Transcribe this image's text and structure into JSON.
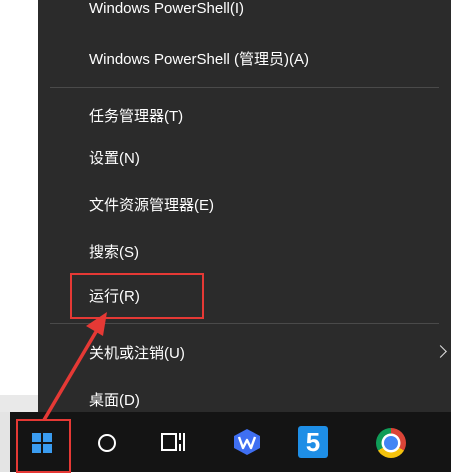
{
  "context_menu": {
    "items": [
      {
        "label": "Windows PowerShell(I)"
      },
      {
        "label": "Windows PowerShell (管理员)(A)"
      },
      {
        "label": "任务管理器(T)"
      },
      {
        "label": "设置(N)"
      },
      {
        "label": "文件资源管理器(E)"
      },
      {
        "label": "搜索(S)"
      },
      {
        "label": "运行(R)"
      },
      {
        "label": "关机或注销(U)"
      },
      {
        "label": "桌面(D)"
      }
    ],
    "submenu_arrow_icon": "chevron-right-icon"
  },
  "taskbar": {
    "icons": [
      "windows-start-icon",
      "cortana-circle-icon",
      "task-view-icon",
      "wps-office-icon",
      "app-5-icon",
      "chrome-icon"
    ],
    "app_5_glyph": "5"
  },
  "annotations": {
    "highlight_color": "#e53935"
  },
  "colors": {
    "menu_bg": "#2b2b2b",
    "menu_text": "#ffffff",
    "taskbar_bg": "#141414",
    "accent": "#3a9cf0"
  }
}
